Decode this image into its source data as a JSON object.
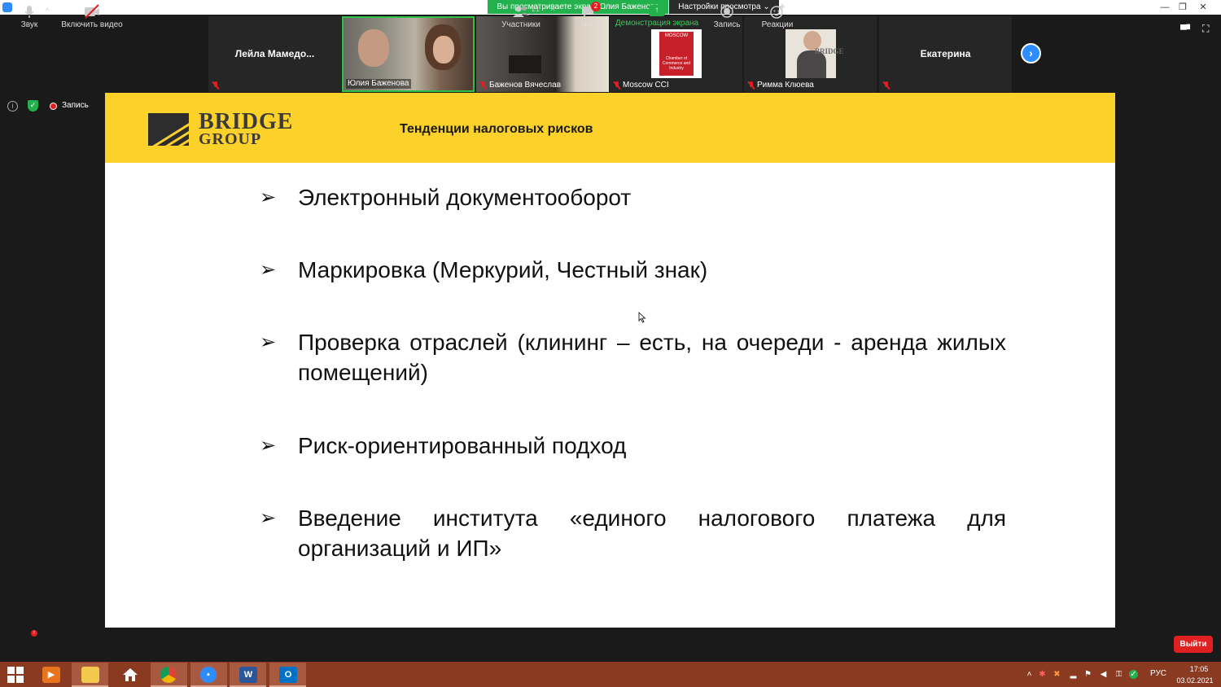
{
  "window": {
    "share_banner": "Вы просматриваете экран Юлия Баженова",
    "view_settings": "Настройки просмотра ⌄",
    "min": "—",
    "restore": "❐",
    "close": "✕"
  },
  "participants_strip": [
    {
      "name": "Лейла  Мамедо...",
      "type": "name-only"
    },
    {
      "name": "Юлия Баженова",
      "type": "video",
      "active_speaker": true
    },
    {
      "name": "Баженов Вячеслав",
      "type": "video"
    },
    {
      "name": "Moscow CCI",
      "type": "avatar"
    },
    {
      "name": "Римма Клюева",
      "type": "avatar"
    },
    {
      "name": "Екатерина",
      "type": "name-only"
    }
  ],
  "logo_moscow": {
    "top": "MOSCOW",
    "sub": "Chamber of Commerce and Industry"
  },
  "logo_bridge_small": "BRIDGE",
  "meeting_info": {
    "record_label": "Запись"
  },
  "slide": {
    "logo_line1": "BRIDGE",
    "logo_line2": "GROUP",
    "title": "Тенденции налоговых рисков",
    "bullets": [
      "Электронный документооборот",
      "Маркировка (Меркурий, Честный знак)",
      "Проверка отраслей (клининг – есть, на очереди - аренда жилых помещений)",
      "Риск-ориентированный подход",
      "Введение института «единого налогового платежа для организаций и ИП»"
    ],
    "bullet_marker": "➢"
  },
  "toolbar": {
    "sound": "Звук",
    "sound_badge": "!",
    "video": "Включить видео",
    "participants": "Участники",
    "participants_count": "21",
    "chat": "Чат",
    "chat_badge": "2",
    "share": "Демонстрация экрана",
    "record": "Запись",
    "reactions": "Реакции",
    "leave": "Выйти"
  },
  "taskbar": {
    "lang": "РУС",
    "time": "17:05",
    "date": "03.02.2021"
  },
  "colors": {
    "slide_header": "#fcd12a",
    "share_green": "#23b14d",
    "zoom_blue": "#2d8cff",
    "leave_red": "#e02020",
    "taskbar": "#8b3a22"
  }
}
